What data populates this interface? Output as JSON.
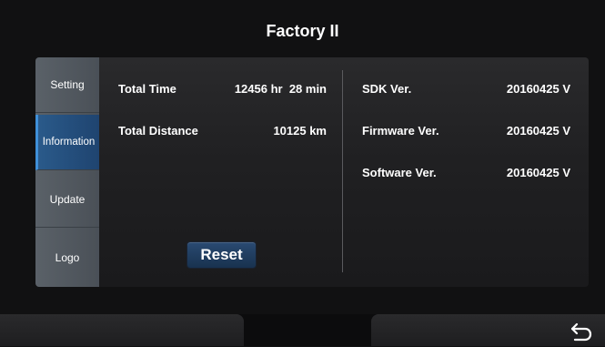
{
  "header": {
    "title": "Factory II"
  },
  "sidebar": {
    "items": [
      {
        "label": "Setting"
      },
      {
        "label": "Information"
      },
      {
        "label": "Update"
      },
      {
        "label": "Logo"
      }
    ],
    "active": "Information"
  },
  "info": {
    "total_time_label": "Total Time",
    "total_time_value": "12456 hr  28 min",
    "total_distance_label": "Total Distance",
    "total_distance_value": "10125 km",
    "sdk_label": "SDK Ver.",
    "sdk_value": "20160425 V",
    "firmware_label": "Firmware Ver.",
    "firmware_value": "20160425 V",
    "software_label": "Software Ver.",
    "software_value": "20160425 V"
  },
  "actions": {
    "reset_label": "Reset"
  },
  "icons": {
    "back": "back-arrow-icon"
  },
  "colors": {
    "active_tab": "#2a5a8a",
    "reset_button": "#1f3b5c",
    "background": "#111112"
  }
}
